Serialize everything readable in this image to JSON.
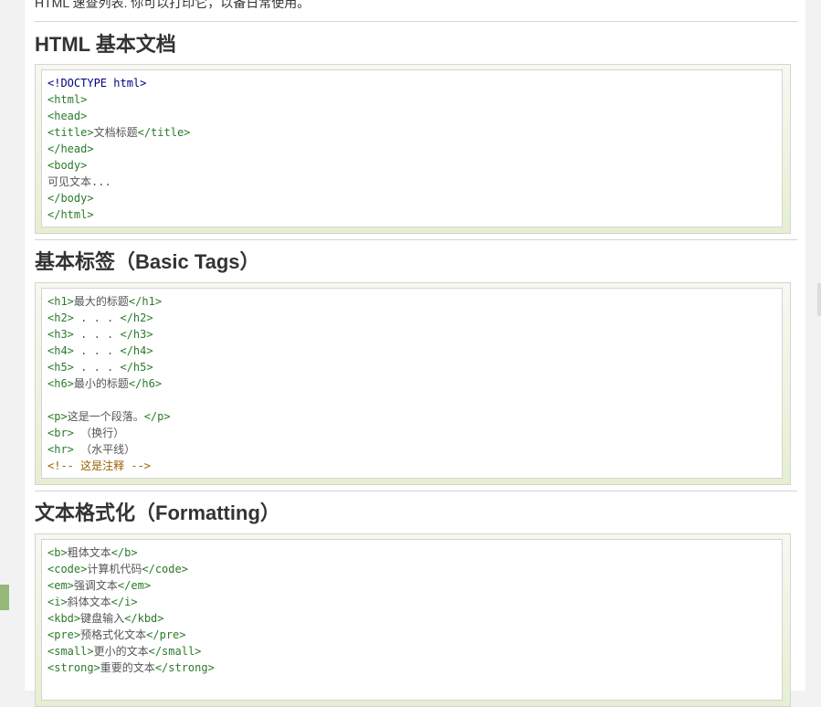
{
  "intro_text": "HTML 速查列表. 你可以打印它，以备日常使用。",
  "sections": [
    {
      "title": "HTML 基本文档",
      "lines": [
        {
          "kind": "doctype",
          "text": "<!DOCTYPE html>"
        },
        {
          "kind": "tag",
          "text": "<html>"
        },
        {
          "kind": "tag",
          "text": "<head>"
        },
        {
          "kind": "mixed",
          "open": "<title>",
          "body": "文档标题",
          "close": "</title>"
        },
        {
          "kind": "tag",
          "text": "</head>"
        },
        {
          "kind": "tag",
          "text": "<body>"
        },
        {
          "kind": "plain",
          "text": "可见文本..."
        },
        {
          "kind": "tag",
          "text": "</body>"
        },
        {
          "kind": "tag",
          "text": "</html>"
        }
      ]
    },
    {
      "title": "基本标签（Basic Tags）",
      "lines": [
        {
          "kind": "mixed",
          "open": "<h1>",
          "body": "最大的标题",
          "close": "</h1>"
        },
        {
          "kind": "mixed",
          "open": "<h2>",
          "body": " . . . ",
          "close": "</h2>"
        },
        {
          "kind": "mixed",
          "open": "<h3>",
          "body": " . . . ",
          "close": "</h3>"
        },
        {
          "kind": "mixed",
          "open": "<h4>",
          "body": " . . . ",
          "close": "</h4>"
        },
        {
          "kind": "mixed",
          "open": "<h5>",
          "body": " . . . ",
          "close": "</h5>"
        },
        {
          "kind": "mixed",
          "open": "<h6>",
          "body": "最小的标题",
          "close": "</h6>"
        },
        {
          "kind": "plain",
          "text": ""
        },
        {
          "kind": "mixed",
          "open": "<p>",
          "body": "这是一个段落。",
          "close": "</p>"
        },
        {
          "kind": "mixed",
          "open": "<br>",
          "body": " （换行）",
          "close": ""
        },
        {
          "kind": "mixed",
          "open": "<hr>",
          "body": " （水平线）",
          "close": ""
        },
        {
          "kind": "comment",
          "text": "<!-- 这是注释 -->"
        }
      ]
    },
    {
      "title": "文本格式化（Formatting）",
      "lines": [
        {
          "kind": "mixed",
          "open": "<b>",
          "body": "粗体文本",
          "close": "</b>"
        },
        {
          "kind": "mixed",
          "open": "<code>",
          "body": "计算机代码",
          "close": "</code>"
        },
        {
          "kind": "mixed",
          "open": "<em>",
          "body": "强调文本",
          "close": "</em>"
        },
        {
          "kind": "mixed",
          "open": "<i>",
          "body": "斜体文本",
          "close": "</i>"
        },
        {
          "kind": "mixed",
          "open": "<kbd>",
          "body": "键盘输入",
          "close": "</kbd>"
        },
        {
          "kind": "mixed",
          "open": "<pre>",
          "body": "预格式化文本",
          "close": "</pre>"
        },
        {
          "kind": "mixed",
          "open": "<small>",
          "body": "更小的文本",
          "close": "</small>"
        },
        {
          "kind": "mixed",
          "open": "<strong>",
          "body": "重要的文本",
          "close": "</strong>"
        }
      ]
    }
  ],
  "colors": {
    "tag": "#2a7a2a",
    "doctype": "#000080",
    "comment": "#9a6000",
    "text": "#555555",
    "accent": "#96b97b"
  }
}
